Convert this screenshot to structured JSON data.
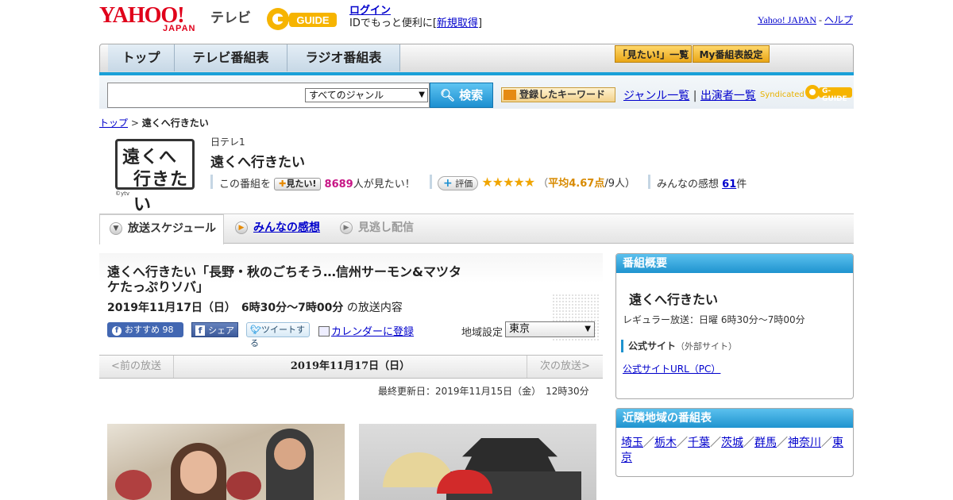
{
  "header": {
    "yahoo_logo": "YAHOO!",
    "yahoo_japan": "JAPAN",
    "tv_label": "テレビ",
    "gguide_logo": "G-GUIDE",
    "login_link": "ログイン",
    "login_text_pre": "IDでもっと便利に[",
    "register_link": "新規取得",
    "login_text_post": "]",
    "yahoo_japan_link": "Yahoo! JAPAN",
    "help_sep": "-",
    "help_link": "ヘルプ"
  },
  "nav": {
    "tabs": [
      {
        "label": "トップ"
      },
      {
        "label": "テレビ番組表"
      },
      {
        "label": "ラジオ番組表"
      }
    ],
    "mitai_list": "「見たい!」一覧",
    "my_schedule": "My番組表設定"
  },
  "search": {
    "input_value": "",
    "genre_selected": "すべてのジャンル",
    "search_button": "検索",
    "keyword_button": "登録したキーワード",
    "genre_list_link": "ジャンル一覧",
    "divider": "|",
    "cast_list_link": "出演者一覧",
    "syndicated": "Syndicated",
    "syndicated_logo": "G-GUIDE"
  },
  "breadcrumb": {
    "home": "トップ",
    "sep": ">",
    "current": "遠くへ行きたい"
  },
  "program": {
    "logo_line1": "遠くへ",
    "logo_line2": "行きたい",
    "logo_credit": "©ytv",
    "station": "日テレ1",
    "title": "遠くへ行きたい",
    "mitai_prefix": "この番組を",
    "mitai_button": "見たい!",
    "mitai_count": "8689",
    "mitai_suffix": "人が見たい！",
    "rate_button": "評価",
    "stars": "★★★★★",
    "rating_open": "（",
    "rating_avg": "平均4.67点",
    "rating_count": "/9人）",
    "impressions_label": "みんなの感想",
    "impressions_count": "61",
    "impressions_unit": "件",
    "rating_value": 4.67
  },
  "tabs": [
    {
      "label": "放送スケジュール"
    },
    {
      "label": "みんなの感想"
    },
    {
      "label": "見逃し配信"
    }
  ],
  "episode": {
    "title": "遠くへ行きたい「長野・秋のごちそう…信州サーモン&マツタケたっぷりソバ」",
    "date": "2019年11月17日（日）　6時30分～7時00分",
    "date_suffix": "の放送内容",
    "fb_like": "おすすめ",
    "fb_count": "98",
    "share_label": "シェア",
    "tweet_label": "ツイートする",
    "calendar_link": "カレンダーに登録",
    "region_label": "地域設定",
    "region_selected": "東京"
  },
  "pager": {
    "prev": "<前の放送",
    "current": "2019年11月17日（日）",
    "next": "次の放送>"
  },
  "updated": "最終更新日：2019年11月15日（金）　12時30分",
  "sidebar": {
    "overview_header": "番組概要",
    "overview_title": "遠くへ行きたい",
    "regular": "レギュラー放送：日曜 6時30分～7時00分",
    "official_label": "公式サイト",
    "official_note": "（外部サイト）",
    "official_url_link": "公式サイトURL（PC）",
    "nearby_header": "近隣地域の番組表",
    "nearby_regions": [
      "埼玉",
      "栃木",
      "千葉",
      "茨城",
      "群馬",
      "神奈川",
      "東京"
    ],
    "region_sep": "／"
  },
  "colors": {
    "accent_blue": "#1f93cf",
    "yahoo_red": "#e0001a",
    "star": "#f0a500",
    "count_pink": "#c71585"
  }
}
